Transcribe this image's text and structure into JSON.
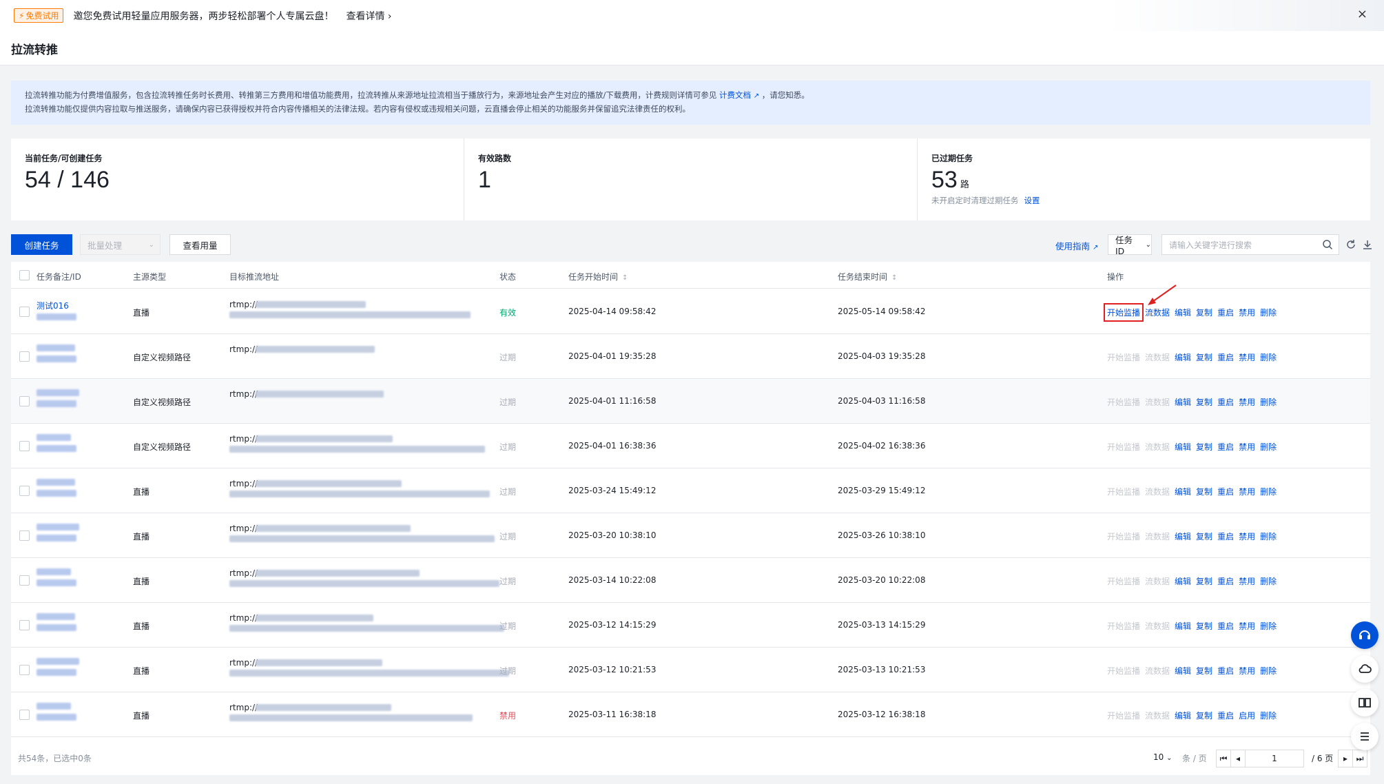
{
  "banner": {
    "badge": "免费试用",
    "message": "邀您免费试用轻量应用服务器，两步轻松部署个人专属云盘！",
    "detail_link": "查看详情 ›",
    "close": "×"
  },
  "page": {
    "title": "拉流转推"
  },
  "notice": {
    "line1_before": "拉流转推功能为付费增值服务，包含拉流转推任务时长费用、转推第三方费用和增值功能费用，拉流转推从来源地址拉流相当于播放行为，来源地址会产生对应的播放/下载费用，计费规则详情可参见",
    "line1_link": "计费文档",
    "line1_after": "，请您知悉。",
    "line2": "拉流转推功能仅提供内容拉取与推送服务，请确保内容已获得授权并符合内容传播相关的法律法规。若内容有侵权或违规相关问题，云直播会停止相关的功能服务并保留追究法律责任的权利。"
  },
  "stats": {
    "tasks_label": "当前任务/可创建任务",
    "tasks_value": "54 / 146",
    "valid_label": "有效路数",
    "valid_value": "1",
    "expired_label": "已过期任务",
    "expired_value": "53",
    "expired_unit": "路",
    "expired_sub": "未开启定时清理过期任务",
    "expired_link": "设置"
  },
  "toolbar": {
    "create": "创建任务",
    "batch": "批量处理",
    "usage": "查看用量",
    "guide": "使用指南",
    "filter": "任务ID",
    "search_placeholder": "请输入关键字进行搜索"
  },
  "table": {
    "headers": {
      "name": "任务备注/ID",
      "source": "主源类型",
      "target": "目标推流地址",
      "status": "状态",
      "start": "任务开始时间",
      "end": "任务结束时间",
      "ops": "操作"
    },
    "rows": [
      {
        "name": "测试016",
        "source": "直播",
        "target": "rtmp://",
        "status": "有效",
        "start": "2025-04-14 09:58:42",
        "end": "2025-05-14 09:58:42",
        "toggle": "禁用"
      },
      {
        "name": "",
        "source": "自定义视频路径",
        "target": "rtmp://",
        "status": "过期",
        "start": "2025-04-01 19:35:28",
        "end": "2025-04-03 19:35:28",
        "toggle": "禁用"
      },
      {
        "name": "",
        "source": "自定义视频路径",
        "target": "rtmp://",
        "status": "过期",
        "start": "2025-04-01 11:16:58",
        "end": "2025-04-03 11:16:58",
        "toggle": "禁用"
      },
      {
        "name": "",
        "source": "自定义视频路径",
        "target": "rtmp://",
        "status": "过期",
        "start": "2025-04-01 16:38:36",
        "end": "2025-04-02 16:38:36",
        "toggle": "禁用"
      },
      {
        "name": "",
        "source": "直播",
        "target": "rtmp://",
        "status": "过期",
        "start": "2025-03-24 15:49:12",
        "end": "2025-03-29 15:49:12",
        "toggle": "禁用"
      },
      {
        "name": "",
        "source": "直播",
        "target": "rtmp://",
        "status": "过期",
        "start": "2025-03-20 10:38:10",
        "end": "2025-03-26 10:38:10",
        "toggle": "禁用"
      },
      {
        "name": "",
        "source": "直播",
        "target": "rtmp://",
        "status": "过期",
        "start": "2025-03-14 10:22:08",
        "end": "2025-03-20 10:22:08",
        "toggle": "禁用"
      },
      {
        "name": "",
        "source": "直播",
        "target": "rtmp://",
        "status": "过期",
        "start": "2025-03-12 14:15:29",
        "end": "2025-03-13 14:15:29",
        "toggle": "禁用"
      },
      {
        "name": "",
        "source": "直播",
        "target": "rtmp://",
        "status": "过期",
        "start": "2025-03-12 10:21:53",
        "end": "2025-03-13 10:21:53",
        "toggle": "禁用"
      },
      {
        "name": "",
        "source": "直播",
        "target": "rtmp://",
        "status": "禁用",
        "start": "2025-03-11 16:38:18",
        "end": "2025-03-12 16:38:18",
        "toggle": "启用"
      }
    ],
    "ops_labels": {
      "monitor": "开始监播",
      "data": "流数据",
      "edit": "编辑",
      "copy": "复制",
      "restart": "重启",
      "delete": "删除"
    }
  },
  "footer": {
    "summary": "共54条，已选中0条",
    "page_size": "10",
    "per_page": "条 / 页",
    "page": "1",
    "total_pages": "/ 6 页"
  },
  "colors": {
    "primary": "#0052d9",
    "valid": "#00a870",
    "disabled": "#e34d59",
    "highlight": "#e02020"
  }
}
